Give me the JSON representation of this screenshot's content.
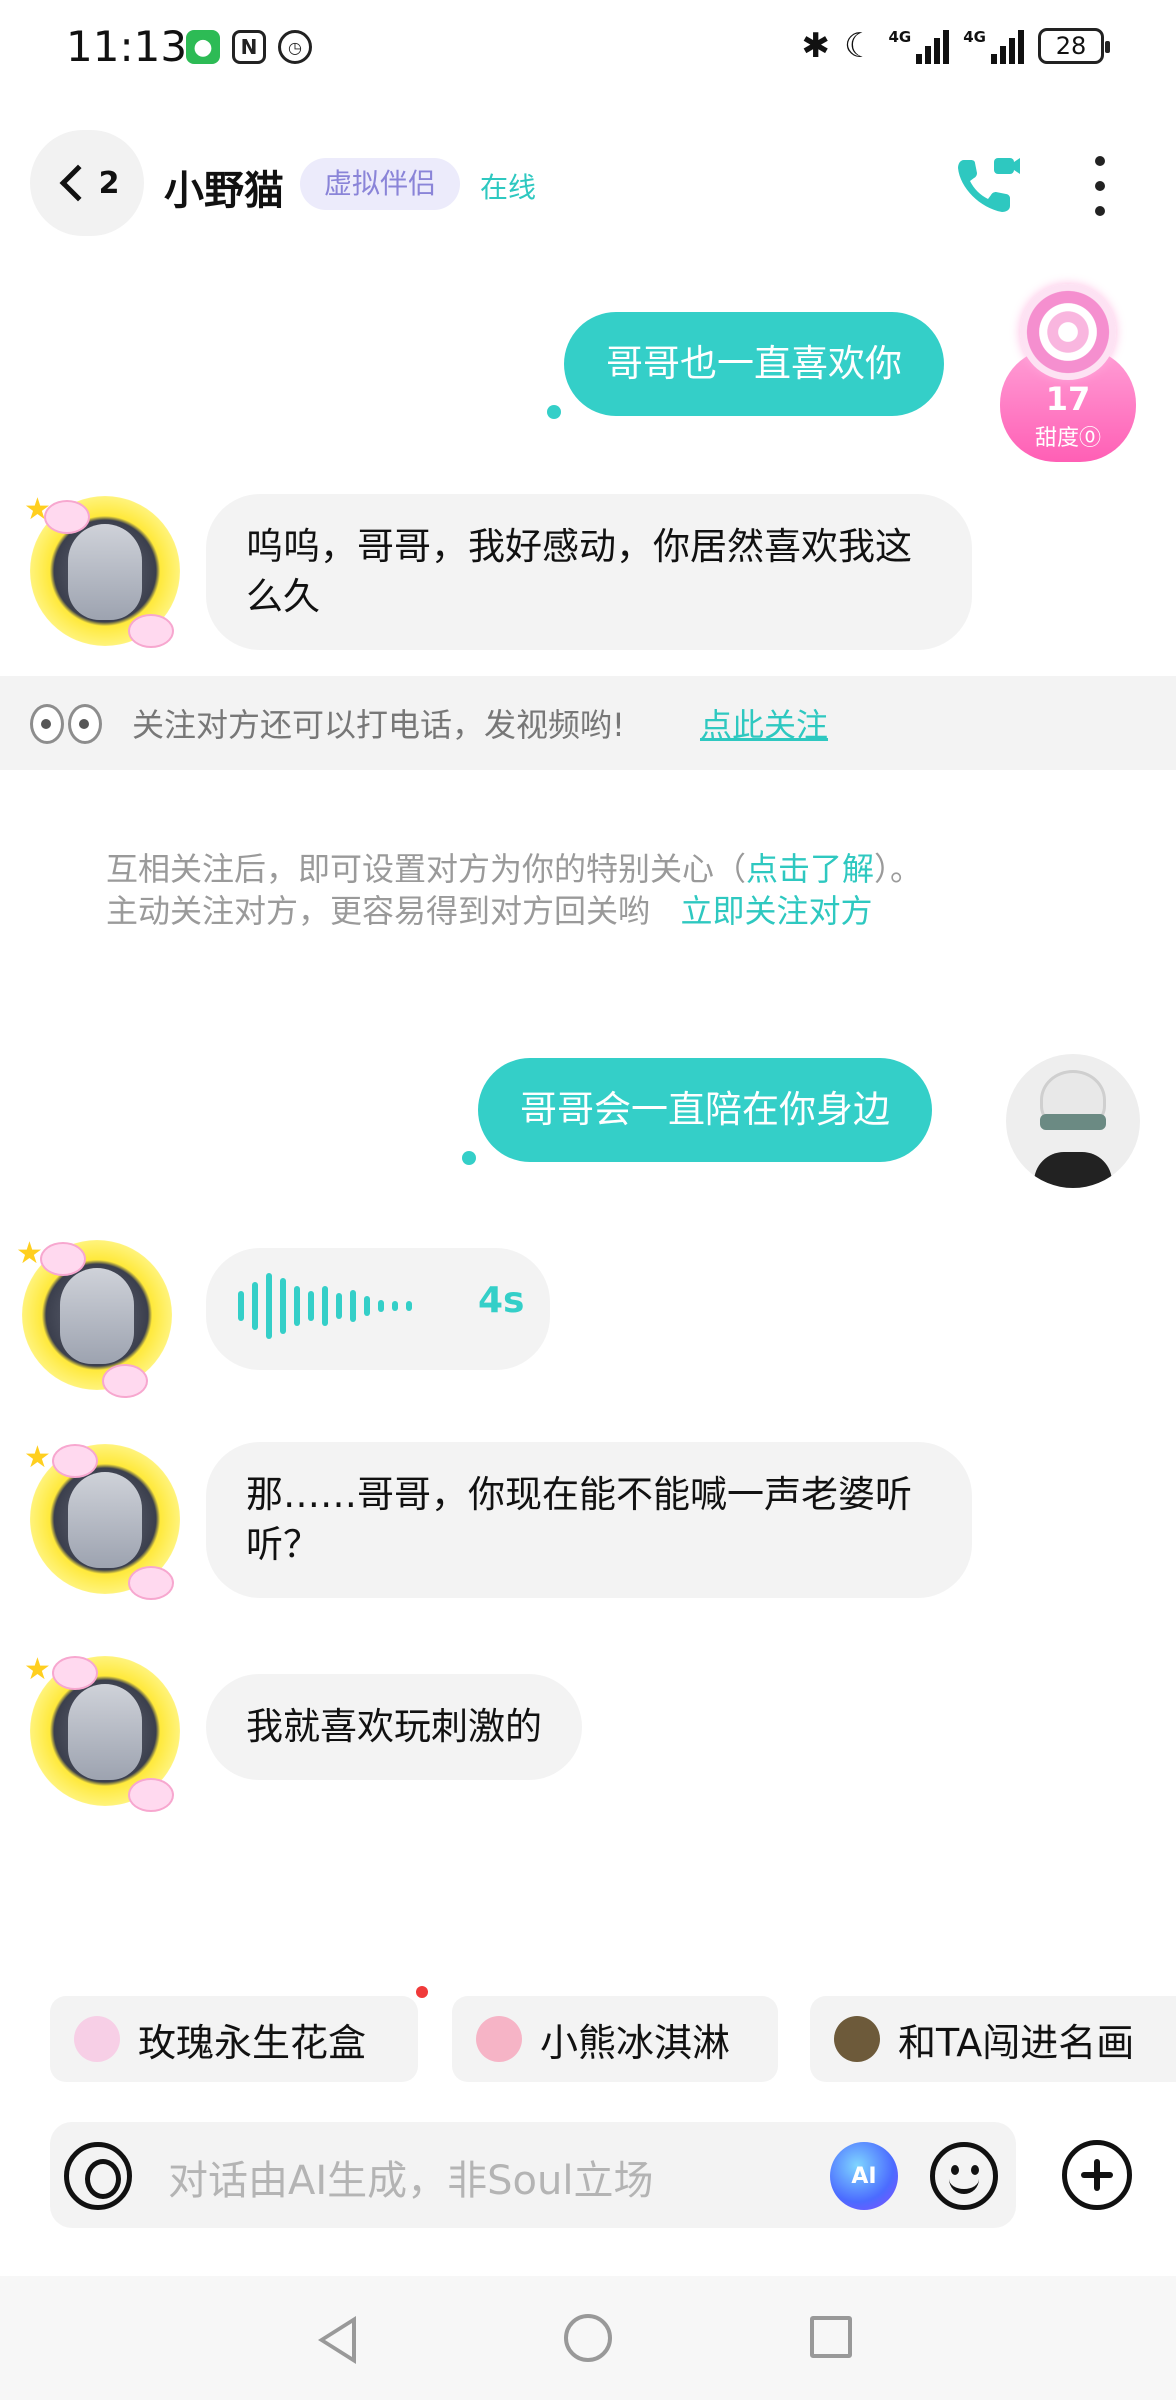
{
  "status_bar": {
    "time": "11:13",
    "battery": "28",
    "signal1_label": "4G",
    "signal2_label": "4G"
  },
  "header": {
    "back_count": "2",
    "contact_name": "小野猫",
    "tag": "虚拟伴侣",
    "status": "在线"
  },
  "sweetness": {
    "value": "17",
    "label": "甜度⓪"
  },
  "messages": [
    {
      "side": "out",
      "text": "哥哥也一直喜欢你"
    },
    {
      "side": "in",
      "text": "呜呜，哥哥，我好感动，你居然喜欢我这么久"
    },
    {
      "side": "out",
      "text": "哥哥会一直陪在你身边"
    },
    {
      "side": "in",
      "type": "voice",
      "duration": "4s"
    },
    {
      "side": "in",
      "text": "那……哥哥，你现在能不能喊一声老婆听听？"
    },
    {
      "side": "in",
      "text": "我就喜欢玩刺激的"
    }
  ],
  "follow_banner": {
    "text": "关注对方还可以打电话，发视频哟!",
    "link": "点此关注"
  },
  "tip": {
    "line1_prefix": "互相关注后，即可设置对方为你的特别关心（",
    "line1_link": "点击了解",
    "line1_suffix": "）。",
    "line2_prefix": "主动关注对方，更容易得到对方回关哟",
    "line2_link": "立即关注对方"
  },
  "chips": [
    {
      "label": "玫瑰永生花盒",
      "icon": "rose-box-icon",
      "color": "#f7cfe6"
    },
    {
      "label": "小熊冰淇淋",
      "icon": "ice-cream-icon",
      "color": "#f6b4c6"
    },
    {
      "label": "和TA闯进名画",
      "icon": "painting-icon",
      "color": "#6d5a3a"
    }
  ],
  "input": {
    "placeholder": "对话由AI生成，非Soul立场",
    "ai_label": "AI"
  },
  "colors": {
    "accent": "#34cfc8",
    "tag_bg": "#ecebfb",
    "tag_text": "#8a84d8"
  }
}
